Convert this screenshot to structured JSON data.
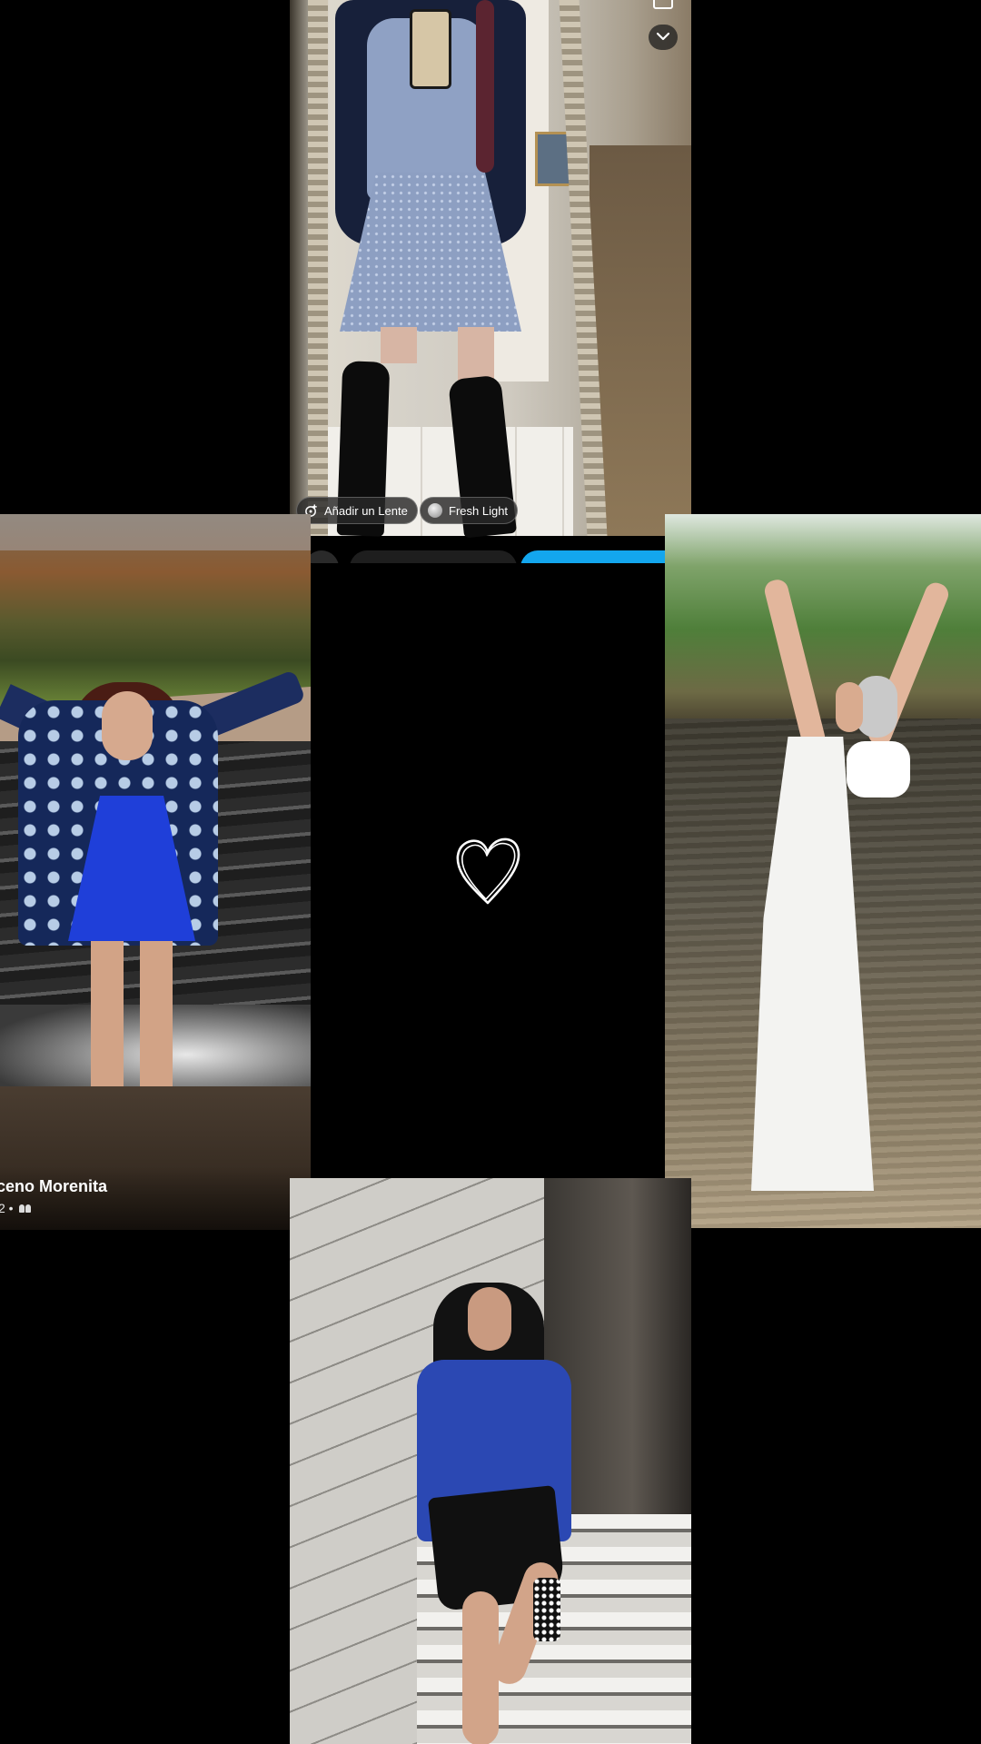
{
  "top_panel": {
    "lens_chip_label": "Añadir un Lente",
    "filter_chip_label": "Fresh Light",
    "icons": {
      "lens": "add-lens-icon",
      "collapse": "chevron-down-icon"
    }
  },
  "left_panel": {
    "name_partial": "ceno Morenita",
    "meta_partial": "2 •",
    "icons": {
      "audience": "friends-icon"
    }
  },
  "center_panel": {
    "icon": "heart-outline-icon"
  },
  "colors": {
    "background": "#000000",
    "send_button": "#13a6ee"
  }
}
